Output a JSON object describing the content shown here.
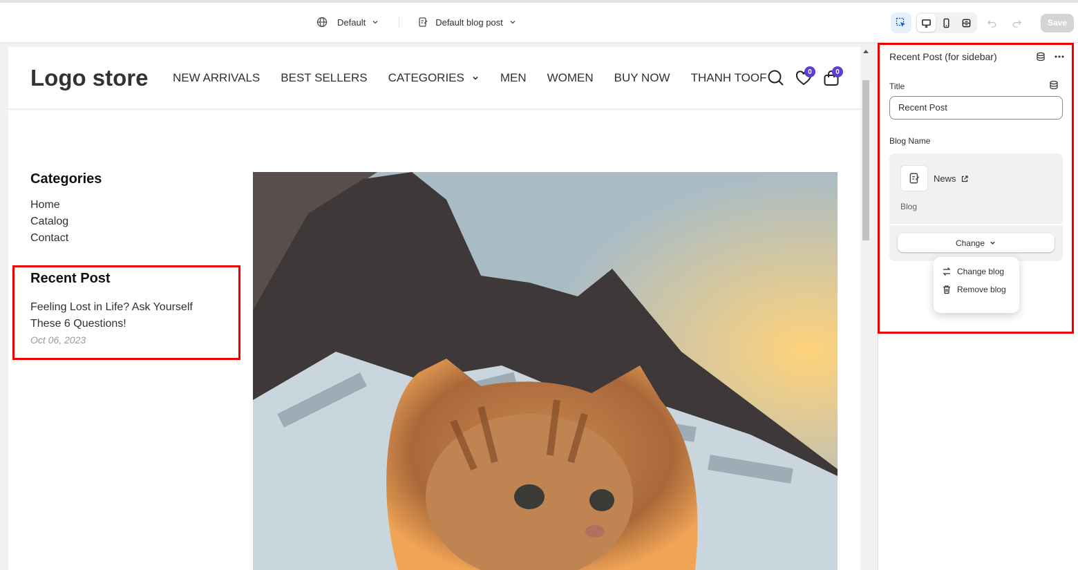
{
  "toolbar": {
    "theme_label": "Default",
    "template_label": "Default blog post",
    "save_label": "Save"
  },
  "store": {
    "logo": "Logo store",
    "nav": [
      "NEW ARRIVALS",
      "BEST SELLERS",
      "CATEGORIES",
      "MEN",
      "WOMEN",
      "BUY NOW",
      "THANH TOOF"
    ],
    "wishlist_count": "0",
    "cart_count": "0"
  },
  "sidebar": {
    "categories_title": "Categories",
    "categories": [
      "Home",
      "Catalog",
      "Contact"
    ],
    "recent_title": "Recent Post",
    "post_title": "Feeling Lost in Life? Ask Yourself These 6 Questions!",
    "post_date": "Oct 06, 2023"
  },
  "panel": {
    "header": "Recent Post (for sidebar)",
    "title_label": "Title",
    "title_value": "Recent Post",
    "blog_label": "Blog Name",
    "blog_name": "News",
    "blog_type": "Blog",
    "change_label": "Change",
    "menu": [
      "Change blog",
      "Remove blog"
    ]
  },
  "colors": {
    "highlight": "#e00000",
    "badge": "#5b3ecf",
    "accent": "#005bd3"
  },
  "icons": [
    "globe-icon",
    "page-icon",
    "chevron-down-icon",
    "inspector-icon",
    "desktop-icon",
    "mobile-icon",
    "fullwidth-icon",
    "undo-icon",
    "redo-icon",
    "search-icon",
    "heart-icon",
    "bag-icon",
    "database-icon",
    "more-icon",
    "external-link-icon",
    "swap-icon",
    "trash-icon"
  ]
}
